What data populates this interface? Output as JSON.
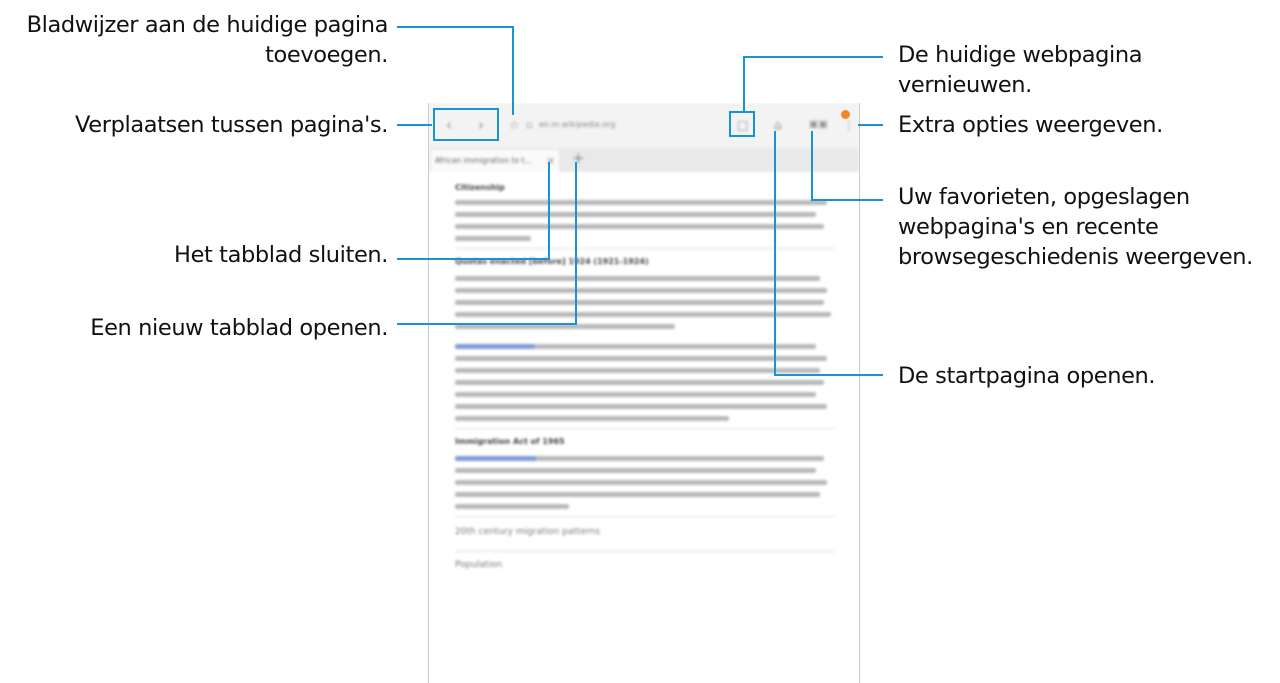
{
  "callouts": {
    "bookmark": [
      "Bladwijzer aan de huidige pagina",
      "toevoegen."
    ],
    "navigate": "Verplaatsen tussen pagina's.",
    "close_tab": "Het tabblad sluiten.",
    "new_tab": "Een nieuw tabblad openen.",
    "refresh": [
      "De huidige webpagina",
      "vernieuwen."
    ],
    "more_options": "Extra opties weergeven.",
    "favorites": [
      "Uw favorieten, opgeslagen",
      "webpagina's en recente",
      "browsegeschiedenis weergeven."
    ],
    "home": "De startpagina openen."
  },
  "browser": {
    "url": "en.m.wikipedia.org",
    "tab_title": "African immigration to t...",
    "icons": {
      "back": "chevron-left-icon",
      "forward": "chevron-right-icon",
      "bookmark": "star-icon",
      "lock": "lock-icon",
      "refresh": "refresh-icon",
      "home": "home-icon",
      "bookmarks": "book-icon",
      "more": "more-vertical-icon",
      "close_tab": "close-icon",
      "new_tab": "plus-icon"
    }
  },
  "page": {
    "sections": [
      "Citizenship",
      "Quotas enacted [before] 1924 (1921-1924)",
      "Immigration Act of 1965",
      "20th century migration patterns",
      "Population"
    ]
  },
  "colors": {
    "accent": "#1694d4",
    "indicator": "#f08a24",
    "link": "#7f9ad6"
  }
}
